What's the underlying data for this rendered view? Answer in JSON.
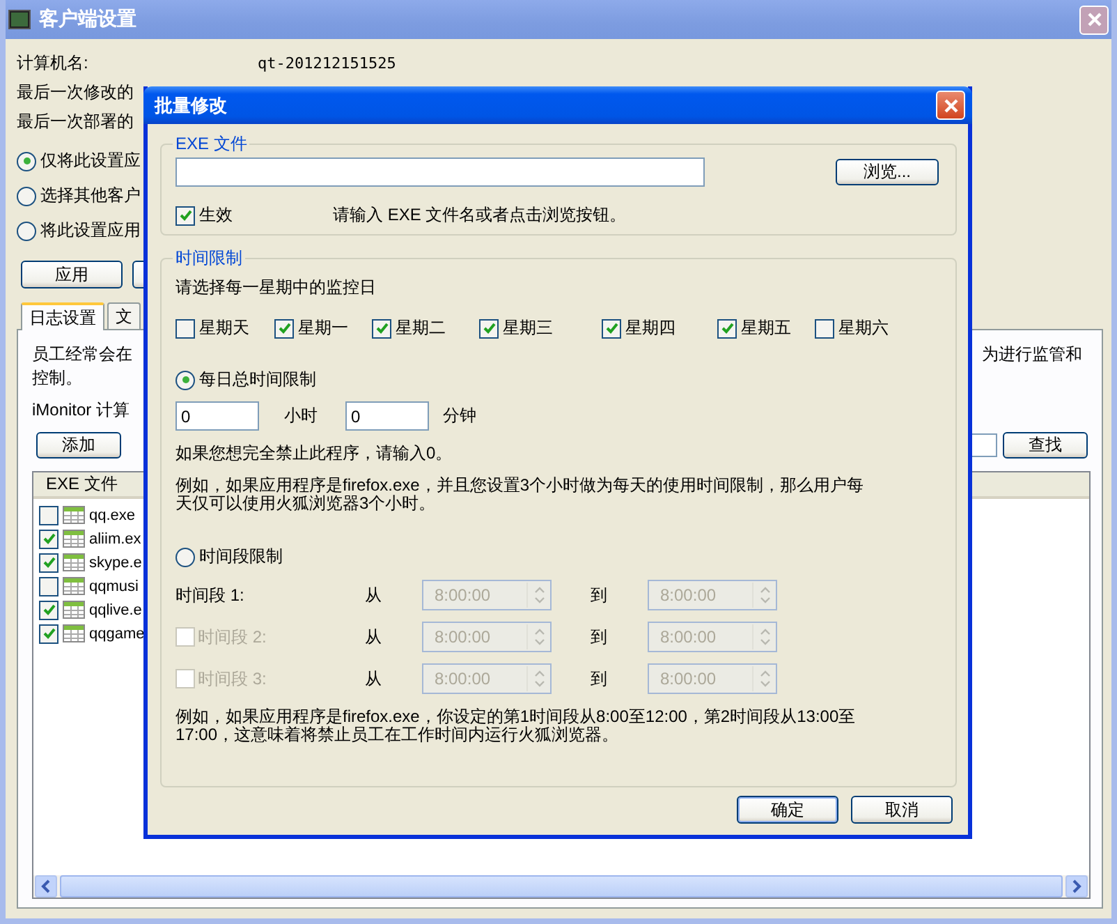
{
  "window": {
    "title": "客户端设置"
  },
  "info": [
    {
      "label": "计算机名:",
      "value": "qt-201212151525"
    },
    {
      "label": "最后一次修改的"
    },
    {
      "label": "最后一次部署的"
    }
  ],
  "scope_options": [
    {
      "label": "仅将此设置应",
      "selected": true
    },
    {
      "label": "选择其他客户",
      "selected": false
    },
    {
      "label": "将此设置应用",
      "selected": false
    }
  ],
  "actions": [
    "应用"
  ],
  "tabs": [
    {
      "label": "日志设置",
      "selected": true
    },
    {
      "label": "文",
      "selected": false
    }
  ],
  "description": {
    "left": "员工经常会在",
    "right": "为进行监管和",
    "line2": "控制。",
    "line3": "iMonitor 计算"
  },
  "add_button": "添加",
  "find_button": "查找",
  "exe_list": {
    "column": "EXE 文件",
    "rows": [
      {
        "name": "qq.exe",
        "checked": false
      },
      {
        "name": "aliim.ex",
        "checked": true
      },
      {
        "name": "skype.e",
        "checked": true
      },
      {
        "name": "qqmusi",
        "checked": false
      },
      {
        "name": "qqlive.e",
        "checked": true
      },
      {
        "name": "qqgame",
        "checked": true
      }
    ]
  },
  "dialog": {
    "title": "批量修改",
    "exe_group": {
      "legend": "EXE 文件",
      "browse": "浏览...",
      "enabled": {
        "label": "生效",
        "checked": true
      },
      "hint": "请输入 EXE 文件名或者点击浏览按钮。"
    },
    "time_group": {
      "legend": "时间限制",
      "days_prompt": "请选择每一星期中的监控日",
      "days": [
        {
          "label": "星期天",
          "checked": false
        },
        {
          "label": "星期一",
          "checked": true
        },
        {
          "label": "星期二",
          "checked": true
        },
        {
          "label": "星期三",
          "checked": true
        },
        {
          "label": "星期四",
          "checked": true
        },
        {
          "label": "星期五",
          "checked": true
        },
        {
          "label": "星期六",
          "checked": false
        }
      ],
      "daily": {
        "label": "每日总时间限制",
        "selected": true,
        "hours": "0",
        "hours_unit": "小时",
        "minutes": "0",
        "minutes_unit": "分钟",
        "note": "如果您想完全禁止此程序，请输入0。",
        "example": "例如，如果应用程序是firefox.exe，并且您设置3个小时做为每天的使用时间限制，那么用户每天仅可以使用火狐浏览器3个小时。"
      },
      "periods": {
        "label": "时间段限制",
        "selected": false,
        "rows": [
          {
            "kind": "plain",
            "label": "时间段 1:",
            "disabled": false,
            "from": "从",
            "start": "8:00:00",
            "to": "到",
            "end": "8:00:00"
          },
          {
            "kind": "checkbox",
            "label": "时间段 2:",
            "checked": false,
            "disabled": true,
            "from": "从",
            "start": "8:00:00",
            "to": "到",
            "end": "8:00:00"
          },
          {
            "kind": "checkbox",
            "label": "时间段 3:",
            "checked": false,
            "disabled": true,
            "from": "从",
            "start": "8:00:00",
            "to": "到",
            "end": "8:00:00"
          }
        ],
        "example": "例如，如果应用程序是firefox.exe，你设定的第1时间段从8:00至12:00，第2时间段从13:00至17:00，这意味着将禁止员工在工作时间内运行火狐浏览器。"
      }
    },
    "buttons": [
      "确定",
      "取消"
    ]
  }
}
